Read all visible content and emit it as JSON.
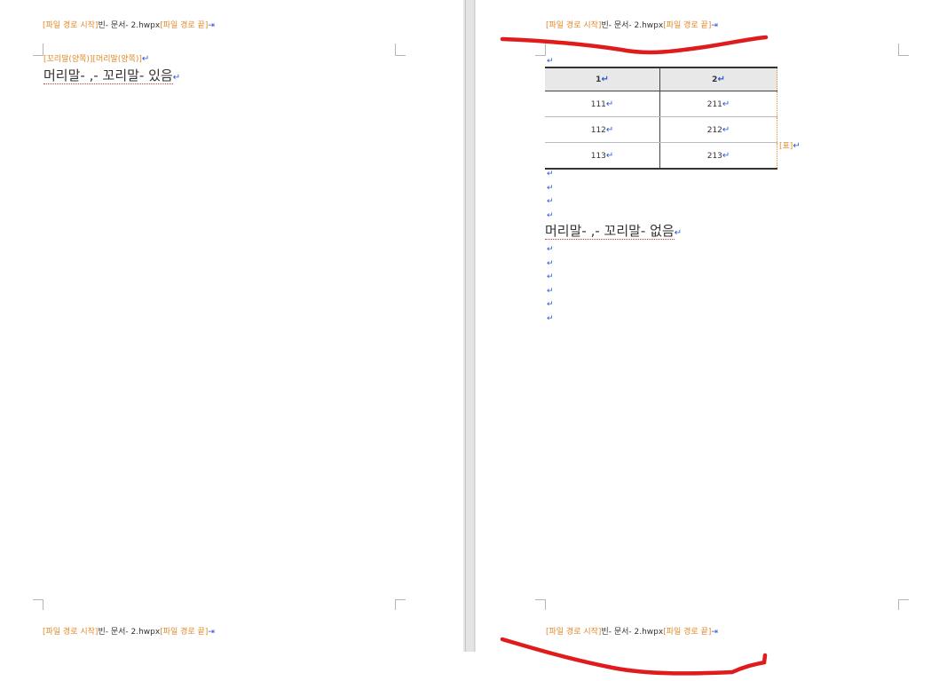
{
  "left_page": {
    "header": {
      "start_code": "[파일 경로 시작]",
      "filename": "빈- 문서- 2.hwpx",
      "end_code": "[파일 경로 끝]"
    },
    "field_codes": "[꼬리말(양쪽)][머리말(양쪽)]",
    "body_text": "머리말- ,- 꼬리말- 있음",
    "footer": {
      "start_code": "[파일 경로 시작]",
      "filename": "빈- 문서- 2.hwpx",
      "end_code": "[파일 경로 끝]"
    }
  },
  "right_page": {
    "header": {
      "start_code": "[파일 경로 시작]",
      "filename": "빈- 문서- 2.hwpx",
      "end_code": "[파일 경로 끝]"
    },
    "table": {
      "headers": [
        "1",
        "2"
      ],
      "rows": [
        [
          "111",
          "211"
        ],
        [
          "112",
          "212"
        ],
        [
          "113",
          "213"
        ]
      ],
      "table_label": "[표]"
    },
    "body_text": "머리말- ,- 꼬리말- 없음",
    "footer": {
      "start_code": "[파일 경로 시작]",
      "filename": "빈- 문서- 2.hwpx",
      "end_code": "[파일 경로 끝]"
    }
  },
  "marks": {
    "paragraph_return": "↵",
    "tab": "⇥"
  },
  "colors": {
    "field_code": "#e08a2a",
    "control_mark": "#2d56d6",
    "annotation": "#e01b1b"
  }
}
